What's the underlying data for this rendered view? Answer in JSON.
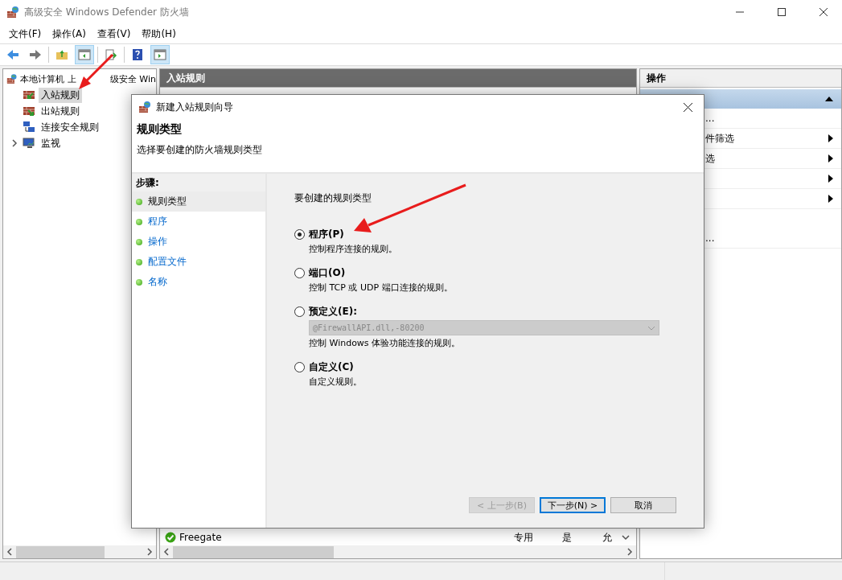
{
  "window": {
    "title": "高级安全 Windows Defender 防火墙"
  },
  "menu": [
    "文件(F)",
    "操作(A)",
    "查看(V)",
    "帮助(H)"
  ],
  "tree": {
    "root_visible_parts": [
      "本地计算机 上",
      "级安全 Win"
    ],
    "items": [
      {
        "label": "入站规则",
        "kind": "inbound",
        "selected": true,
        "expandable": false
      },
      {
        "label": "出站规则",
        "kind": "outbound",
        "selected": false,
        "expandable": false
      },
      {
        "label": "连接安全规则",
        "kind": "security",
        "selected": false,
        "expandable": false
      },
      {
        "label": "监视",
        "kind": "monitor",
        "selected": false,
        "expandable": true
      }
    ]
  },
  "center": {
    "title": "入站规则",
    "rows": [
      {
        "name": "Freegate",
        "profile": "专用",
        "enabled": "是",
        "action": "允"
      }
    ]
  },
  "actions": {
    "title": "操作",
    "items": [
      {
        "label": "...",
        "submenu": false
      },
      {
        "label": "件筛选",
        "submenu": true
      },
      {
        "label": "选",
        "submenu": true
      },
      {
        "submenu": true
      },
      {
        "submenu": true
      },
      {
        "label": "...",
        "submenu": false
      }
    ]
  },
  "dialog": {
    "title": "新建入站规则向导",
    "heading": "规则类型",
    "subheading": "选择要创建的防火墙规则类型",
    "steps_title": "步骤:",
    "steps": [
      {
        "label": "规则类型",
        "selected": true
      },
      {
        "label": "程序",
        "selected": false
      },
      {
        "label": "操作",
        "selected": false
      },
      {
        "label": "配置文件",
        "selected": false
      },
      {
        "label": "名称",
        "selected": false
      }
    ],
    "prompt": "要创建的规则类型",
    "options": [
      {
        "label": "程序(P)",
        "description": "控制程序连接的规则。",
        "selected": true
      },
      {
        "label": "端口(O)",
        "description": "控制 TCP 或 UDP 端口连接的规则。",
        "selected": false
      },
      {
        "label": "预定义(E):",
        "dropdown": {
          "value": "@FirewallAPI.dll,-80200",
          "disabled": true
        },
        "description": "控制 Windows 体验功能连接的规则。",
        "selected": false
      },
      {
        "label": "自定义(C)",
        "description": "自定义规则。",
        "selected": false
      }
    ],
    "buttons": [
      {
        "label": "< 上一步(B)",
        "disabled": true,
        "default": false
      },
      {
        "label": "下一步(N) >",
        "disabled": false,
        "default": true
      },
      {
        "label": "取消",
        "disabled": false,
        "default": false
      }
    ]
  }
}
